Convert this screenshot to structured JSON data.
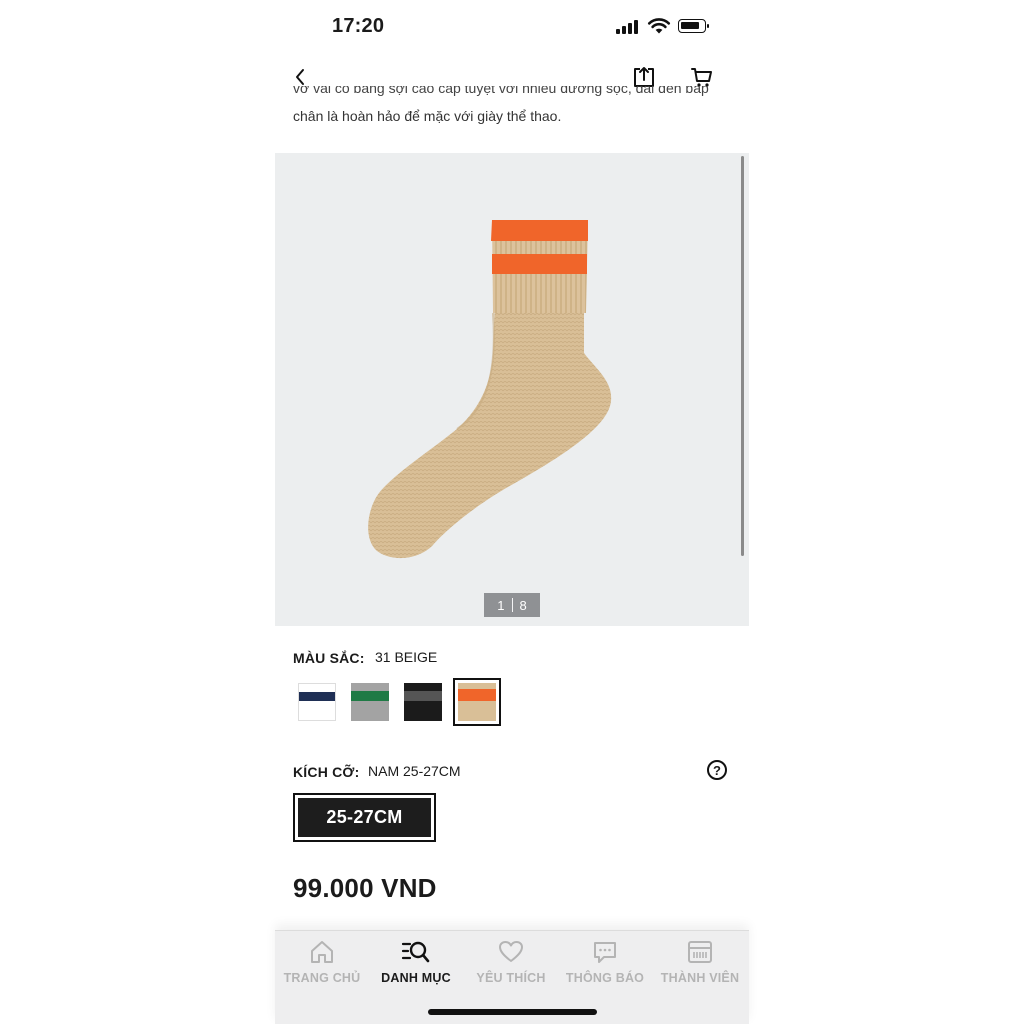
{
  "status_bar": {
    "time": "17:20"
  },
  "header": {
    "back_icon": "chevron-left-icon",
    "share_icon": "share-icon",
    "cart_icon": "cart-icon"
  },
  "description": {
    "partial_line": "vớ vải cổ bằng sợi cao cấp tuyệt với nhiều đường sọc, dài đến bắp",
    "line": "chân là hoàn hảo để mặc với giày thể thao."
  },
  "gallery": {
    "current": "1",
    "total": "8"
  },
  "color": {
    "label": "MÀU SẮC:",
    "value": "31 BEIGE",
    "swatches": [
      {
        "name": "navy",
        "base": "#ffffff",
        "stripe": "#1f2f55",
        "selected": false
      },
      {
        "name": "green",
        "base": "#9e9e9e",
        "stripe": "#1f7a45",
        "selected": false
      },
      {
        "name": "black",
        "base": "#1b1b1b",
        "stripe": "#555555",
        "selected": false
      },
      {
        "name": "beige",
        "base": "#d9bf97",
        "stripe": "#f0652a",
        "selected": true
      }
    ]
  },
  "size": {
    "label": "KÍCH CỠ:",
    "value": "NAM 25-27CM",
    "help_icon": "question-circle-icon",
    "options": [
      "25-27CM"
    ]
  },
  "price": "99.000 VND",
  "nav": [
    {
      "label": "TRANG CHỦ",
      "icon": "home-icon",
      "active": false
    },
    {
      "label": "DANH MỤC",
      "icon": "catalog-search-icon",
      "active": true
    },
    {
      "label": "YÊU THÍCH",
      "icon": "heart-icon",
      "active": false
    },
    {
      "label": "THÔNG BÁO",
      "icon": "chat-bubble-icon",
      "active": false
    },
    {
      "label": "THÀNH VIÊN",
      "icon": "member-card-icon",
      "active": false
    }
  ],
  "colors": {
    "accent_orange": "#f0652a",
    "sock_beige": "#d9bf97",
    "image_bg": "#eceeef"
  }
}
